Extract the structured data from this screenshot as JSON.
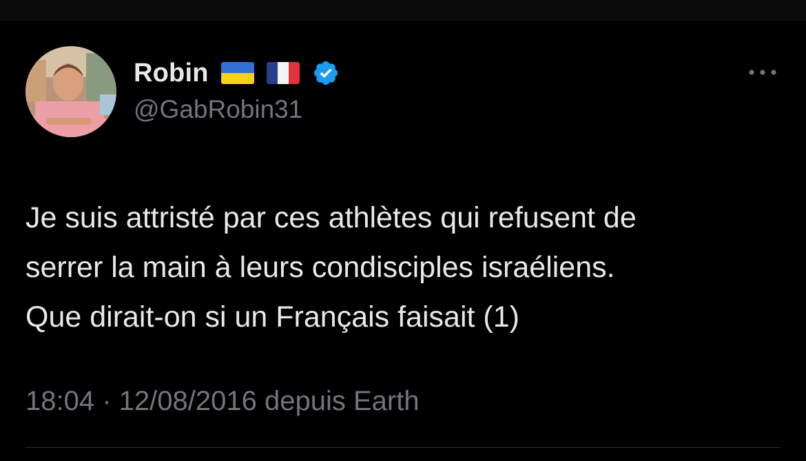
{
  "tweet": {
    "author": {
      "display_name": "Robin",
      "handle": "@GabRobin31",
      "flags": [
        "ukraine-flag",
        "france-flag"
      ],
      "verified": true
    },
    "text_lines": [
      "Je suis attristé par ces athlètes qui refusent de",
      "serrer la main à leurs condisciples israéliens.",
      "Que dirait-on si un Français faisait (1)"
    ],
    "time": "18:04",
    "separator": "·",
    "date": "12/08/2016",
    "source": "depuis Earth"
  },
  "colors": {
    "background": "#000000",
    "text_primary": "#e7e9ea",
    "text_secondary": "#71767b",
    "verified_blue": "#1d9bf0",
    "divider": "#2f3336"
  },
  "icons": {
    "verified": "verified-badge-icon",
    "more": "more-options-icon"
  }
}
